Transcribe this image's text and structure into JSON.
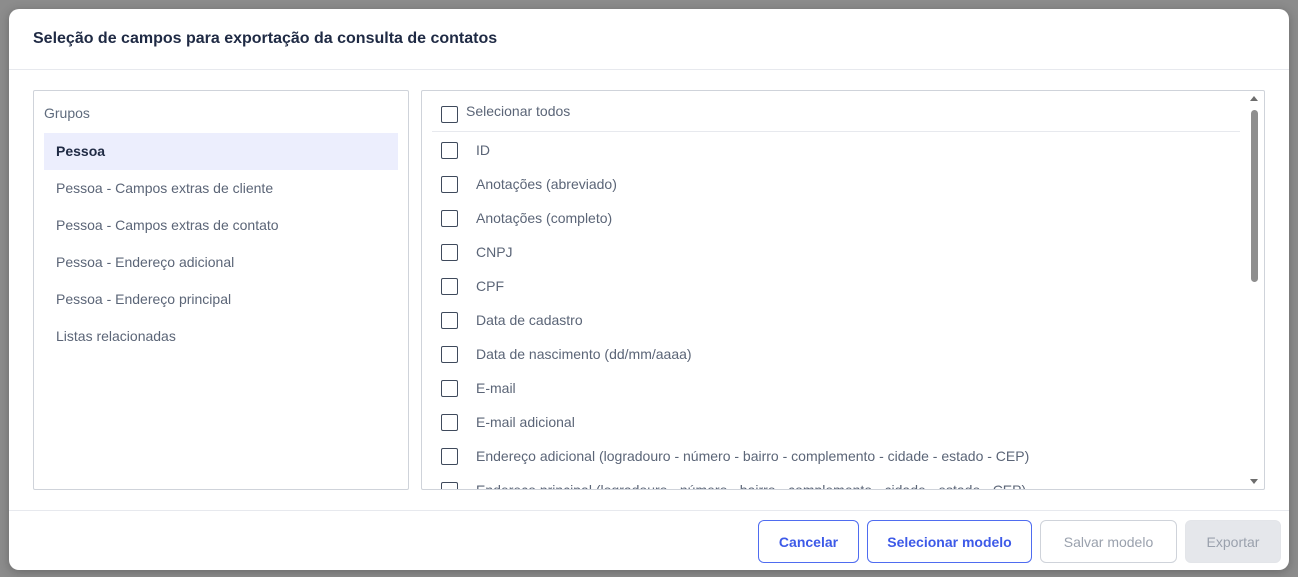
{
  "modal": {
    "title": "Seleção de campos para exportação da consulta de contatos"
  },
  "groups": {
    "title": "Grupos",
    "items": [
      {
        "label": "Pessoa",
        "active": true
      },
      {
        "label": "Pessoa - Campos extras de cliente",
        "active": false
      },
      {
        "label": "Pessoa - Campos extras de contato",
        "active": false
      },
      {
        "label": "Pessoa - Endereço adicional",
        "active": false
      },
      {
        "label": "Pessoa - Endereço principal",
        "active": false
      },
      {
        "label": "Listas relacionadas",
        "active": false
      }
    ]
  },
  "fields": {
    "select_all_label": "Selecionar todos",
    "items": [
      {
        "label": "ID",
        "checked": false
      },
      {
        "label": "Anotações (abreviado)",
        "checked": false
      },
      {
        "label": "Anotações (completo)",
        "checked": false
      },
      {
        "label": "CNPJ",
        "checked": false
      },
      {
        "label": "CPF",
        "checked": false
      },
      {
        "label": "Data de cadastro",
        "checked": false
      },
      {
        "label": "Data de nascimento (dd/mm/aaaa)",
        "checked": false
      },
      {
        "label": "E-mail",
        "checked": false
      },
      {
        "label": "E-mail adicional",
        "checked": false
      },
      {
        "label": "Endereço adicional (logradouro - número - bairro - complemento - cidade - estado - CEP)",
        "checked": false
      },
      {
        "label": "Endereço principal (logradouro - número - bairro - complemento - cidade - estado - CEP)",
        "checked": false
      }
    ]
  },
  "footer": {
    "cancel_label": "Cancelar",
    "select_model_label": "Selecionar modelo",
    "save_model_label": "Salvar modelo",
    "export_label": "Exportar"
  },
  "colors": {
    "accent": "#3d5ae8",
    "active_group_bg": "#eceefd",
    "disabled_text": "#9aa1ad"
  }
}
